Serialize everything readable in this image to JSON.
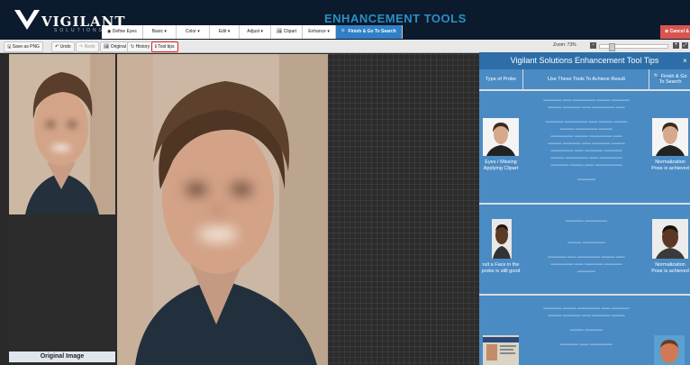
{
  "header": {
    "logo_word": "VIGILANT",
    "logo_sub": "SOLUTIONS",
    "app_title": "ENHANCEMENT TOOLS",
    "menu": [
      {
        "label": "◉ Define Eyes"
      },
      {
        "label": "Basic ▾"
      },
      {
        "label": "Color ▾"
      },
      {
        "label": "Edit ▾"
      },
      {
        "label": "Adjust ▾"
      },
      {
        "label": "🖼 Clipart"
      },
      {
        "label": "Enhance ▾"
      },
      {
        "label": "🔍 Finish & Go To Search"
      }
    ],
    "cancel_label": "⊗ Cancel & Close"
  },
  "toolbar": {
    "save": "🖫 Save as PNG",
    "undo": "↶ Undo",
    "redo": "↷ Redo",
    "original": "🖼 Original",
    "history": "↻ History",
    "tooltips": "ℹ Tool tips",
    "zoom": "Zoom: 73%",
    "zoom_percent": 73
  },
  "panels": {
    "original_label": "Original Image"
  },
  "tips": {
    "title": "Vigilant Solutions Enhancement Tool Tips",
    "columns": [
      "Type of Probe",
      "Use These Tools To Achieve Result",
      "🔍 Finish & Go To Search"
    ],
    "rows": [
      {
        "probe": "Eyes / Missing Applying Clipart",
        "result": "Normalization Pose is achieved"
      },
      {
        "probe": "ruit a Face in the probe is still good",
        "result": "Normalization Pose is achieved"
      },
      {
        "probe": "",
        "result": ""
      }
    ]
  },
  "colors": {
    "header_bg": "#0b1a2c",
    "title_blue": "#2a8fc6",
    "primary_blue": "#2f80c8",
    "cancel_red": "#d9534f",
    "tips_blue": "#4a8bc4",
    "highlight_red": "#e02020"
  }
}
